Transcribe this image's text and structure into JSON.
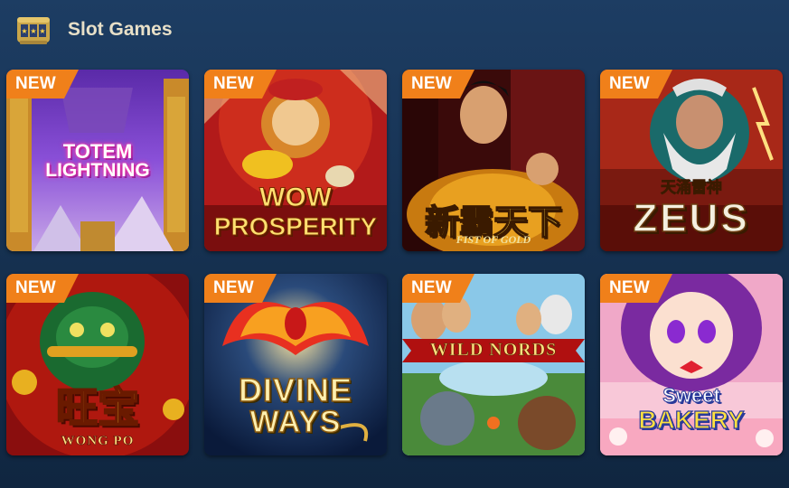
{
  "header": {
    "title": "Slot Games",
    "icon": "slot-machine-icon"
  },
  "games": [
    {
      "id": "totem-lightning",
      "badge": "NEW",
      "title_lines": [
        "TOTEM",
        "LIGHTNING"
      ],
      "subtitle": ""
    },
    {
      "id": "wow-prosperity",
      "badge": "NEW",
      "title_lines": [
        "WOW",
        "PROSPERITY"
      ],
      "subtitle": ""
    },
    {
      "id": "fist-of-gold",
      "badge": "NEW",
      "title_lines": [
        "新霸天下"
      ],
      "subtitle": "FIST OF GOLD"
    },
    {
      "id": "zeus",
      "badge": "NEW",
      "title_lines": [
        "天涌雷神",
        "ZEUS"
      ],
      "subtitle": ""
    },
    {
      "id": "wong-po",
      "badge": "NEW",
      "title_lines": [
        "旺宝"
      ],
      "subtitle": "WONG PO"
    },
    {
      "id": "divine-ways",
      "badge": "NEW",
      "title_lines": [
        "DIVINE",
        "WAYS"
      ],
      "subtitle": ""
    },
    {
      "id": "wild-nords",
      "badge": "NEW",
      "title_lines": [
        "WILD NORDS"
      ],
      "subtitle": ""
    },
    {
      "id": "sweet-bakery",
      "badge": "NEW",
      "title_lines": [
        "Sweet",
        "BAKERY"
      ],
      "subtitle": ""
    }
  ],
  "colors": {
    "background": "#17324f",
    "badge": "#f0801a",
    "header_text": "#e8e0c8"
  }
}
